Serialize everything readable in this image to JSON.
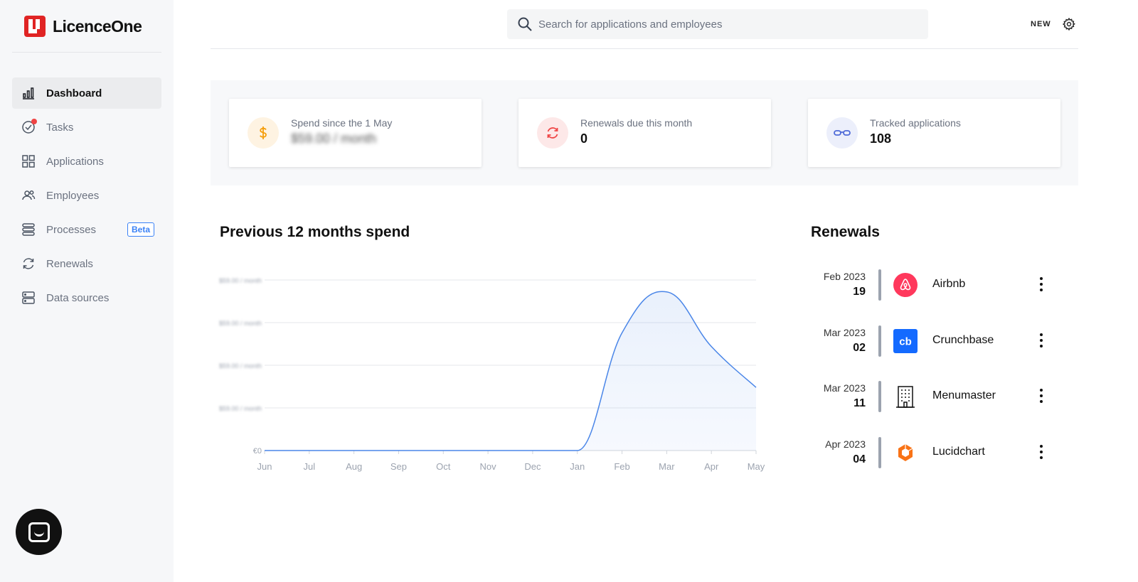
{
  "app": {
    "name": "LicenceOne"
  },
  "sidebar": {
    "items": [
      {
        "label": "Dashboard",
        "icon": "bar-chart-icon",
        "active": true
      },
      {
        "label": "Tasks",
        "icon": "check-circle-icon"
      },
      {
        "label": "Applications",
        "icon": "grid-icon"
      },
      {
        "label": "Employees",
        "icon": "users-icon"
      },
      {
        "label": "Processes",
        "icon": "process-icon",
        "badge": "Beta"
      },
      {
        "label": "Renewals",
        "icon": "refresh-icon"
      },
      {
        "label": "Data sources",
        "icon": "server-icon"
      }
    ]
  },
  "header": {
    "search_placeholder": "Search for applications and employees",
    "new_label": "NEW"
  },
  "stats": [
    {
      "label": "Spend since the 1 May",
      "value": "$59.00 / month",
      "icon": "dollar-icon",
      "color": "#f59e0b",
      "bg": "#fef3e2"
    },
    {
      "label": "Renewals due this month",
      "value": "0",
      "icon": "refresh-icon",
      "color": "#ef4444",
      "bg": "#fde8e8"
    },
    {
      "label": "Tracked applications",
      "value": "108",
      "icon": "glasses-icon",
      "color": "#4f6bd8",
      "bg": "#eceffb"
    }
  ],
  "chart": {
    "title": "Previous 12 months spend",
    "y_ticks": [
      "$59.00 / month",
      "$59.00 / month",
      "$59.00 / month",
      "$59.00 / month",
      "€0"
    ]
  },
  "chart_data": {
    "type": "area",
    "categories": [
      "Jun",
      "Jul",
      "Aug",
      "Sep",
      "Oct",
      "Nov",
      "Dec",
      "Jan",
      "Feb",
      "Mar",
      "Apr",
      "May"
    ],
    "values": [
      0,
      0,
      0,
      0,
      0,
      0,
      0,
      0,
      69,
      93,
      61,
      37
    ],
    "ylim": [
      0,
      100
    ],
    "grid": true,
    "color": "#4a86e8"
  },
  "renewals": {
    "title": "Renewals",
    "items": [
      {
        "month": "Feb 2023",
        "day": "19",
        "name": "Airbnb",
        "logo": "airbnb-logo-icon"
      },
      {
        "month": "Mar 2023",
        "day": "02",
        "name": "Crunchbase",
        "logo": "crunchbase-logo-icon"
      },
      {
        "month": "Mar 2023",
        "day": "11",
        "name": "Menumaster",
        "logo": "building-icon"
      },
      {
        "month": "Apr 2023",
        "day": "04",
        "name": "Lucidchart",
        "logo": "lucidchart-logo-icon"
      }
    ]
  }
}
